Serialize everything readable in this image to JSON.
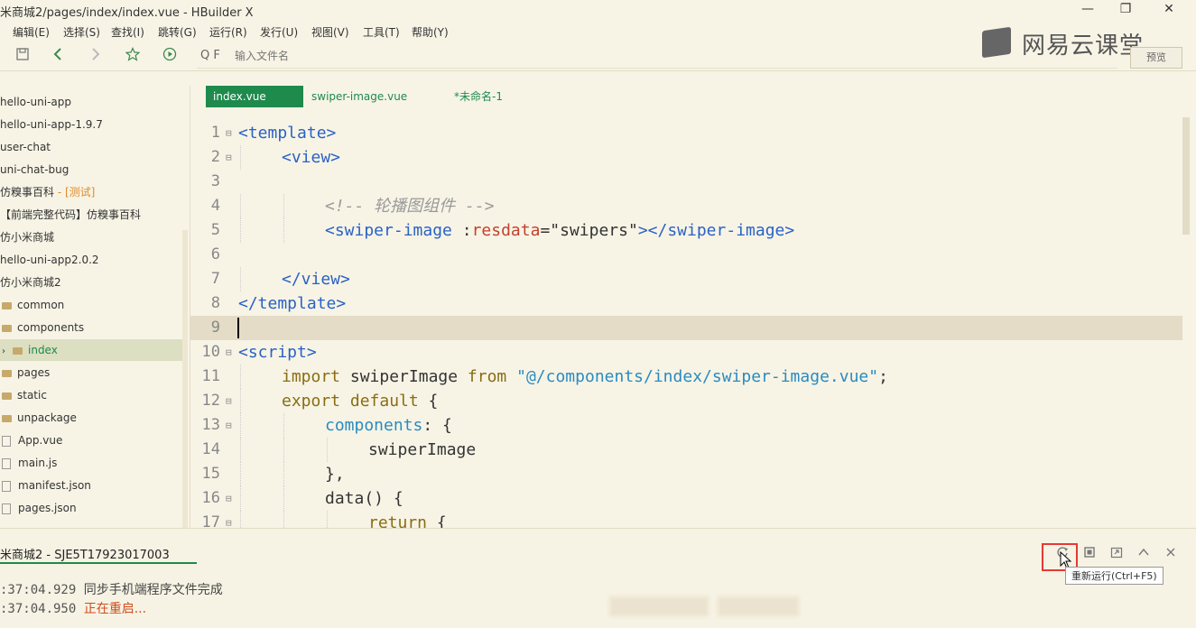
{
  "window": {
    "title": "米商城2/pages/index/index.vue - HBuilder X",
    "controls": [
      "—",
      "❐",
      "✕"
    ]
  },
  "menu": [
    "编辑(E)",
    "选择(S)",
    "查找(I)",
    "跳转(G)",
    "运行(R)",
    "发行(U)",
    "视图(V)",
    "工具(T)",
    "帮助(Y)"
  ],
  "toolbar": {
    "search_placeholder": "输入文件名",
    "search_icon_label": "Q F",
    "preview_label": "预览"
  },
  "logo": {
    "text": "网易云课堂"
  },
  "sidebar": {
    "items": [
      {
        "label": "hello-uni-app",
        "kind": "project"
      },
      {
        "label": "hello-uni-app-1.9.7",
        "kind": "project"
      },
      {
        "label": "user-chat",
        "kind": "project"
      },
      {
        "label": "uni-chat-bug",
        "kind": "project"
      },
      {
        "label": "仿糗事百科",
        "tag": " - [测试]",
        "kind": "project"
      },
      {
        "label": "【前端完整代码】仿糗事百科",
        "kind": "project"
      },
      {
        "label": "仿小米商城",
        "kind": "project"
      },
      {
        "label": "hello-uni-app2.0.2",
        "kind": "project"
      },
      {
        "label": "仿小米商城2",
        "kind": "project"
      },
      {
        "label": "common",
        "kind": "folder"
      },
      {
        "label": "components",
        "kind": "folder"
      },
      {
        "label": "index",
        "kind": "folder",
        "selected": true
      },
      {
        "label": "pages",
        "kind": "folder"
      },
      {
        "label": "static",
        "kind": "folder"
      },
      {
        "label": "unpackage",
        "kind": "folder"
      },
      {
        "label": "App.vue",
        "kind": "file"
      },
      {
        "label": "main.js",
        "kind": "file"
      },
      {
        "label": "manifest.json",
        "kind": "file"
      },
      {
        "label": "pages.json",
        "kind": "file"
      }
    ]
  },
  "tabs": [
    {
      "label": "index.vue",
      "active": true
    },
    {
      "label": "swiper-image.vue",
      "active": false
    },
    {
      "label": "*未命名-1",
      "active": false
    }
  ],
  "editor": {
    "current_line": 9,
    "lines": [
      {
        "n": "1",
        "fold": true,
        "indent": 0,
        "tokens": [
          [
            "t",
            "<template>"
          ]
        ]
      },
      {
        "n": "2",
        "fold": true,
        "indent": 1,
        "tokens": [
          [
            "t",
            "<view>"
          ]
        ]
      },
      {
        "n": "3",
        "fold": false,
        "indent": 0,
        "tokens": []
      },
      {
        "n": "4",
        "fold": false,
        "indent": 2,
        "tokens": [
          [
            "c",
            "<!-- 轮播图组件 -->"
          ]
        ]
      },
      {
        "n": "5",
        "fold": false,
        "indent": 2,
        "tokens": [
          [
            "t",
            "<swiper-image"
          ],
          [
            "g",
            " :"
          ],
          [
            "a",
            "resdata"
          ],
          [
            "g",
            "="
          ],
          [
            "s",
            "\"swipers\""
          ],
          [
            "t",
            "></swiper-image>"
          ]
        ]
      },
      {
        "n": "6",
        "fold": false,
        "indent": 0,
        "tokens": []
      },
      {
        "n": "7",
        "fold": false,
        "indent": 1,
        "tokens": [
          [
            "t",
            "</view>"
          ]
        ]
      },
      {
        "n": "8",
        "fold": false,
        "indent": 0,
        "tokens": [
          [
            "t",
            "</template>"
          ]
        ]
      },
      {
        "n": "9",
        "fold": false,
        "indent": 0,
        "tokens": []
      },
      {
        "n": "10",
        "fold": true,
        "indent": 0,
        "tokens": [
          [
            "t",
            "<script>"
          ]
        ]
      },
      {
        "n": "11",
        "fold": false,
        "indent": 1,
        "tokens": [
          [
            "k",
            "import"
          ],
          [
            "g",
            " swiperImage "
          ],
          [
            "k",
            "from"
          ],
          [
            "g",
            " "
          ],
          [
            "p",
            "\"@/components/index/swiper-image.vue\""
          ],
          [
            "g",
            ";"
          ]
        ]
      },
      {
        "n": "12",
        "fold": true,
        "indent": 1,
        "tokens": [
          [
            "k",
            "export default"
          ],
          [
            "g",
            " {"
          ]
        ]
      },
      {
        "n": "13",
        "fold": true,
        "indent": 2,
        "tokens": [
          [
            "p",
            "components"
          ],
          [
            "g",
            ": {"
          ]
        ]
      },
      {
        "n": "14",
        "fold": false,
        "indent": 3,
        "tokens": [
          [
            "g",
            "swiperImage"
          ]
        ]
      },
      {
        "n": "15",
        "fold": false,
        "indent": 2,
        "tokens": [
          [
            "g",
            "},"
          ]
        ]
      },
      {
        "n": "16",
        "fold": true,
        "indent": 2,
        "tokens": [
          [
            "g",
            "data() {"
          ]
        ]
      },
      {
        "n": "17",
        "fold": true,
        "indent": 3,
        "tokens": [
          [
            "k",
            "return"
          ],
          [
            "g",
            " {"
          ]
        ]
      }
    ]
  },
  "console": {
    "tab_label": "米商城2 - SJE5T17923017003",
    "logs": [
      {
        "time": ":37:04.929",
        "text": "同步手机端程序文件完成",
        "type": "ok"
      },
      {
        "time": ":37:04.950",
        "text": "正在重启...",
        "type": "warn"
      }
    ],
    "tooltip": "重新运行(Ctrl+F5)"
  },
  "colors": {
    "accent": "#1e8a4c",
    "background": "#f7f4e6",
    "highlight_box": "#e53935"
  }
}
